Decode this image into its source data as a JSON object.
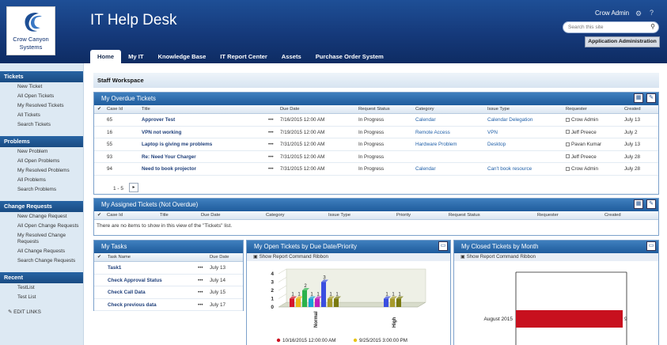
{
  "header": {
    "logo_line1": "Crow Canyon",
    "logo_line2": "Systems",
    "title": "IT Help Desk",
    "user": "Crow Admin",
    "search_placeholder": "Search this site",
    "admin_button": "Application Administration",
    "nav": [
      "Home",
      "My IT",
      "Knowledge Base",
      "IT Report Center",
      "Assets",
      "Purchase Order System"
    ]
  },
  "sidebar": {
    "sections": [
      {
        "title": "Tickets",
        "items": [
          "New Ticket",
          "All Open Tickets",
          "My Resolved Tickets",
          "All Tickets",
          "Search Tickets"
        ]
      },
      {
        "title": "Problems",
        "items": [
          "New Problem",
          "All Open Problems",
          "My Resolved Problems",
          "All Problems",
          "Search Problems"
        ]
      },
      {
        "title": "Change Requests",
        "items": [
          "New Change Request",
          "All Open Change Requests",
          "My Resolved Change Requests",
          "All Change Requests",
          "Search Change Requests"
        ]
      },
      {
        "title": "Recent",
        "items": [
          "TestList",
          "Test List"
        ]
      }
    ],
    "edit_links": "EDIT LINKS"
  },
  "workspace": {
    "title": "Staff Workspace"
  },
  "overdue": {
    "title": "My Overdue Tickets",
    "columns": [
      "Case Id",
      "Title",
      "Due Date",
      "Request Status",
      "Category",
      "Issue Type",
      "Requester",
      "Created"
    ],
    "rows": [
      {
        "id": "65",
        "title": "Approver Test",
        "due": "7/16/2015 12:00 AM",
        "status": "In Progress",
        "category": "Calendar",
        "issue": "Calendar Delegation",
        "requester": "Crow Admin",
        "created": "July 13"
      },
      {
        "id": "16",
        "title": "VPN not working",
        "due": "7/19/2015 12:00 AM",
        "status": "In Progress",
        "category": "Remote Access",
        "issue": "VPN",
        "requester": "Jeff Preece",
        "created": "July 2"
      },
      {
        "id": "55",
        "title": "Laptop is giving me problems",
        "due": "7/31/2015 12:00 AM",
        "status": "In Progress",
        "category": "Hardware Problem",
        "issue": "Desktop",
        "requester": "Pavan Kumar",
        "created": "July 13"
      },
      {
        "id": "93",
        "title": "Re: Need Your Charger",
        "due": "7/31/2015 12:00 AM",
        "status": "In Progress",
        "category": "",
        "issue": "",
        "requester": "Jeff Preece",
        "created": "July 28"
      },
      {
        "id": "94",
        "title": "Need to book projector",
        "due": "7/31/2015 12:00 AM",
        "status": "In Progress",
        "category": "Calendar",
        "issue": "Can't book resource",
        "requester": "Crow Admin",
        "created": "July 28"
      }
    ],
    "pager": "1 - 5",
    "ellipsis": "•••"
  },
  "assigned": {
    "title": "My Assigned Tickets (Not Overdue)",
    "columns": [
      "Case Id",
      "Title",
      "Due Date",
      "Category",
      "Issue Type",
      "Priority",
      "Request Status",
      "Requester",
      "Created"
    ],
    "empty": "There are no items to show in this view of the \"Tickets\" list."
  },
  "tasks": {
    "title": "My Tasks",
    "columns": [
      "Task Name",
      "Due Date"
    ],
    "rows": [
      {
        "name": "Task1",
        "due": "July 13"
      },
      {
        "name": "Check Approval Status",
        "due": "July 14"
      },
      {
        "name": "Check Call Data",
        "due": "July 15"
      },
      {
        "name": "Check previous data",
        "due": "July 17"
      }
    ]
  },
  "open_chart": {
    "title": "My Open Tickets by Due Date/Priority",
    "ribbon": "Show Report Command Ribbon",
    "legend": [
      "10/16/2015 12:00:00 AM",
      "9/25/2015 3:00:00 PM"
    ]
  },
  "closed_chart": {
    "title": "My Closed Tickets by Month",
    "ribbon": "Show Report Command Ribbon"
  },
  "chart_data": [
    {
      "type": "bar",
      "title": "My Open Tickets by Due Date/Priority",
      "categories": [
        "Normal",
        "High"
      ],
      "ylim": [
        0,
        4
      ],
      "yticks": [
        "0",
        "1",
        "2",
        "3",
        "4"
      ],
      "groups": [
        {
          "category": "Normal",
          "values": [
            1,
            1,
            2,
            1,
            1,
            3,
            1,
            1
          ]
        },
        {
          "category": "High",
          "values": [
            1,
            1,
            1
          ]
        }
      ],
      "colors": [
        "#d4162c",
        "#e8b817",
        "#2bb24c",
        "#1aa0d8",
        "#c01fbd",
        "#3a4ee0",
        "#a89b2b",
        "#7a7a10"
      ],
      "legend_colors": [
        "#cc1122",
        "#e8c414"
      ]
    },
    {
      "type": "bar",
      "title": "My Closed Tickets by Month",
      "orientation": "horizontal",
      "categories": [
        "August 2015"
      ],
      "values": [
        9
      ],
      "value_label": "9",
      "color": "#c8101e"
    }
  ]
}
